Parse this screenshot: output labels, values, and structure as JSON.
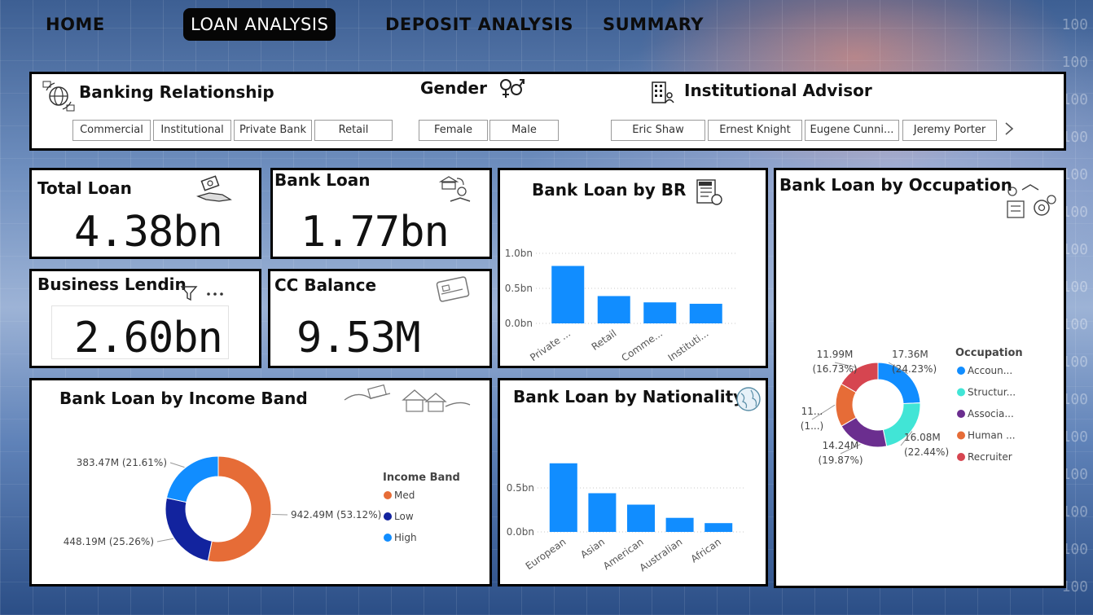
{
  "nav": {
    "home": "HOME",
    "loan_analysis": "LOAN ANALYSIS",
    "deposit_analysis": "DEPOSIT ANALYSIS",
    "summary": "SUMMARY"
  },
  "background_numbers": [
    "100",
    "100",
    "100",
    "100",
    "100",
    "100",
    "100",
    "100",
    "100",
    "100",
    "100",
    "100",
    "100",
    "100",
    "100",
    "100"
  ],
  "slicers": {
    "banking_relationship": {
      "title": "Banking Relationship",
      "options": [
        "Commercial",
        "Institutional",
        "Private Bank",
        "Retail"
      ]
    },
    "gender": {
      "title": "Gender",
      "options": [
        "Female",
        "Male"
      ]
    },
    "institutional_advisor": {
      "title": "Institutional Advisor",
      "options": [
        "Eric Shaw",
        "Ernest Knight",
        "Eugene Cunni...",
        "Jeremy Porter"
      ]
    }
  },
  "kpis": {
    "total_loan": {
      "title": "Total Loan",
      "value": "4.38bn"
    },
    "bank_loan": {
      "title": "Bank Loan",
      "value": "1.77bn"
    },
    "business_lending": {
      "title": "Business Lendin",
      "value": "2.60bn"
    },
    "cc_balance": {
      "title": "CC Balance",
      "value": "9.53M"
    }
  },
  "colors": {
    "bar": "#118dff",
    "med": "#e66c37",
    "low": "#12239e",
    "high": "#118dff",
    "accountant": "#118dff",
    "structural": "#41e5d6",
    "associate": "#6b2e8f",
    "human": "#e66c37",
    "recruiter": "#d64550"
  },
  "chart_data": [
    {
      "id": "br",
      "type": "bar",
      "title": "Bank Loan by BR",
      "categories": [
        "Private ...",
        "Retail",
        "Comme...",
        "Instituti..."
      ],
      "values": [
        0.82,
        0.39,
        0.3,
        0.28
      ],
      "yticks": [
        "1.0bn",
        "0.5bn",
        "0.0bn"
      ],
      "ylim": [
        0,
        1.0
      ],
      "grid": true
    },
    {
      "id": "nationality",
      "type": "bar",
      "title": "Bank Loan by Nationality",
      "categories": [
        "European",
        "Asian",
        "American",
        "Australian",
        "African"
      ],
      "values": [
        0.78,
        0.44,
        0.31,
        0.16,
        0.1
      ],
      "yticks": [
        "0.5bn",
        "0.0bn"
      ],
      "ylim": [
        0,
        0.5
      ],
      "grid": true
    },
    {
      "id": "income",
      "type": "pie",
      "title": "Bank Loan by Income Band",
      "legend_title": "Income Band",
      "legend_position": "right",
      "slices": [
        {
          "name": "Med",
          "value": 942.49,
          "label": "942.49M (53.12%)",
          "color": "#e66c37"
        },
        {
          "name": "Low",
          "value": 448.19,
          "label": "448.19M (25.26%)",
          "color": "#12239e"
        },
        {
          "name": "High",
          "value": 383.47,
          "label": "383.47M (21.61%)",
          "color": "#118dff"
        }
      ]
    },
    {
      "id": "occupation",
      "type": "pie",
      "title": "Bank Loan by Occupation",
      "legend_title": "Occupation",
      "legend_position": "right",
      "slices": [
        {
          "name": "Accoun...",
          "value": 17.36,
          "label_value": "17.36M",
          "label_pct": "(24.23%)",
          "color": "#118dff"
        },
        {
          "name": "Structur...",
          "value": 16.08,
          "label_value": "16.08M",
          "label_pct": "(22.44%)",
          "color": "#41e5d6"
        },
        {
          "name": "Associa...",
          "value": 14.24,
          "label_value": "14.24M",
          "label_pct": "(19.87%)",
          "color": "#6b2e8f"
        },
        {
          "name": "Human ...",
          "value": 11.9,
          "label_value": "11...",
          "label_pct": "(1...)",
          "color": "#e66c37"
        },
        {
          "name": "Recruiter",
          "value": 11.99,
          "label_value": "11.99M",
          "label_pct": "(16.73%)",
          "color": "#d64550"
        }
      ]
    }
  ]
}
